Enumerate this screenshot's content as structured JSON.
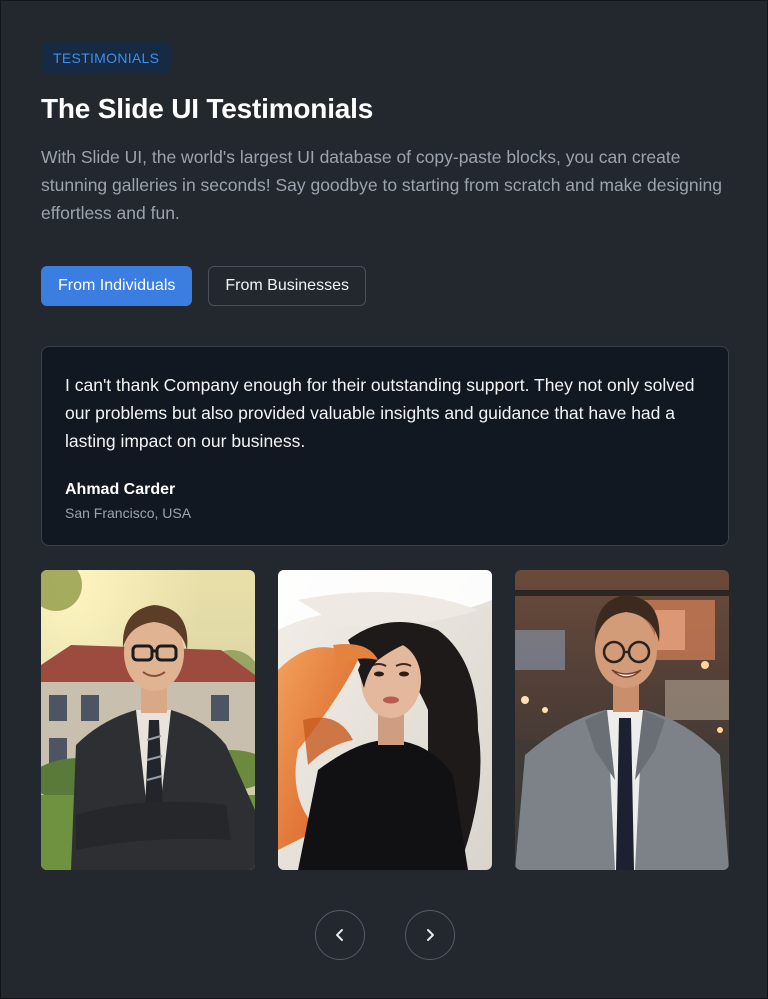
{
  "header": {
    "badge": "TESTIMONIALS",
    "title": "The Slide UI Testimonials",
    "description": "With Slide UI, the world's largest UI database of copy-paste blocks, you can create stunning galleries in seconds! Say goodbye to starting from scratch and make designing effortless and fun."
  },
  "tabs": [
    {
      "label": "From Individuals",
      "active": true
    },
    {
      "label": "From Businesses",
      "active": false
    }
  ],
  "testimonial": {
    "quote": "I can't thank Company enough for their outstanding support. They not only solved our problems but also provided valuable insights and guidance that have had a lasting impact on our business.",
    "author_name": "Ahmad Carder",
    "author_location": "San Francisco, USA"
  },
  "gallery": {
    "photos": [
      {
        "subject": "man-in-suit-with-glasses-outdoors"
      },
      {
        "subject": "woman-with-flowing-hair"
      },
      {
        "subject": "smiling-man-in-gray-suit-indoors"
      }
    ]
  },
  "navigation": {
    "prev_icon": "chevron-left-icon",
    "next_icon": "chevron-right-icon"
  },
  "colors": {
    "background": "#23282f",
    "accent": "#3b7de0",
    "card": "#121821",
    "badge_bg": "#162a44",
    "badge_text": "#3b8ff0"
  }
}
